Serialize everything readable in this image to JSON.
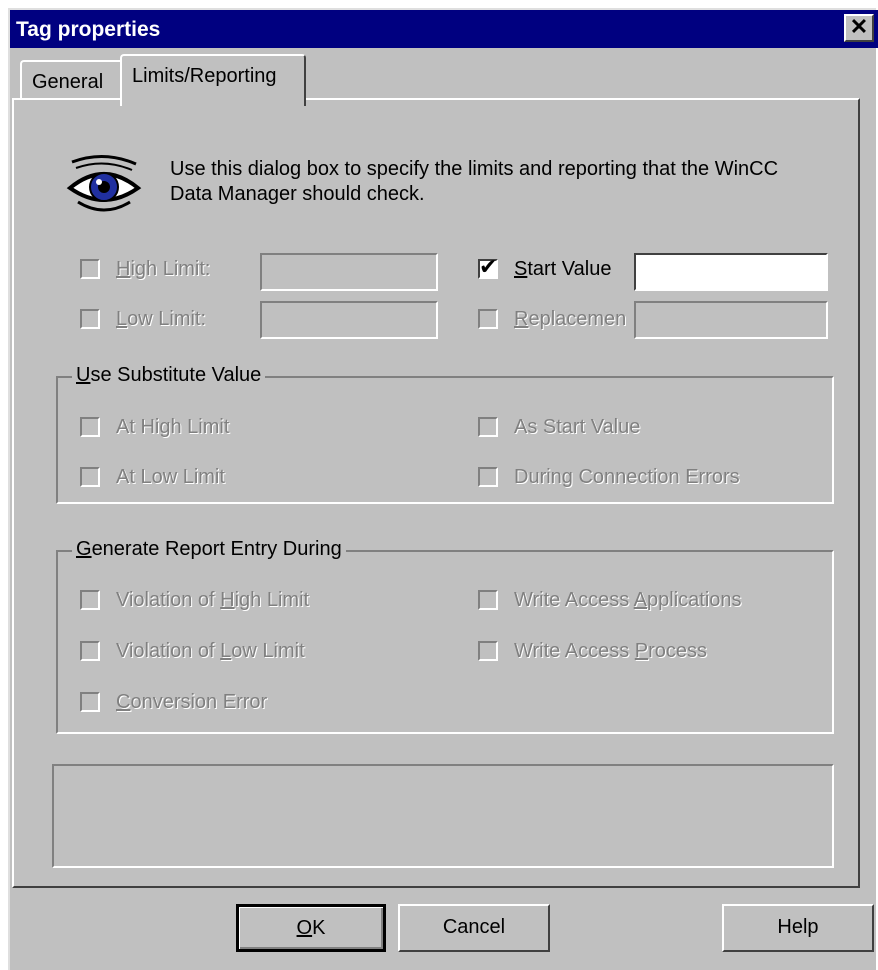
{
  "title": "Tag properties",
  "close_label": "✕",
  "tabs": [
    "General",
    "Limits/Reporting"
  ],
  "intro": "Use this dialog box to specify the limits and reporting that the WinCC Data Manager should check.",
  "limits": {
    "high_limit": {
      "pre": "",
      "key": "H",
      "post": "igh Limit:",
      "checked": false,
      "enabled": false
    },
    "low_limit": {
      "pre": "",
      "key": "L",
      "post": "ow Limit:",
      "checked": false,
      "enabled": false
    },
    "start_value": {
      "pre": "",
      "key": "S",
      "post": "tart Value",
      "checked": true,
      "enabled": true,
      "value": ""
    },
    "replacement": {
      "pre": "",
      "key": "R",
      "post": "eplacemen",
      "checked": false,
      "enabled": false
    }
  },
  "substitute": {
    "legend_key": "U",
    "legend_rest": "se Substitute Value",
    "at_high": "At High Limit",
    "at_low": "At Low Limit",
    "as_start": "As Start Value",
    "during_conn": "During Connection Errors"
  },
  "report": {
    "legend_key": "G",
    "legend_rest": "enerate Report Entry During",
    "violation_high": {
      "pre": "Violation of ",
      "key": "H",
      "post": "igh Limit"
    },
    "violation_low": {
      "pre": "Violation of ",
      "key": "L",
      "post": "ow Limit"
    },
    "conversion": {
      "pre": "",
      "key": "C",
      "post": "onversion Error"
    },
    "write_apps": {
      "pre": "Write Access ",
      "key": "A",
      "post": "pplications"
    },
    "write_process": {
      "pre": "Write Access ",
      "key": "P",
      "post": "rocess"
    }
  },
  "buttons": {
    "ok_key": "O",
    "ok_rest": "K",
    "cancel": "Cancel",
    "help": "Help"
  },
  "icons": {
    "eye": "eye-icon",
    "check": "✔"
  }
}
